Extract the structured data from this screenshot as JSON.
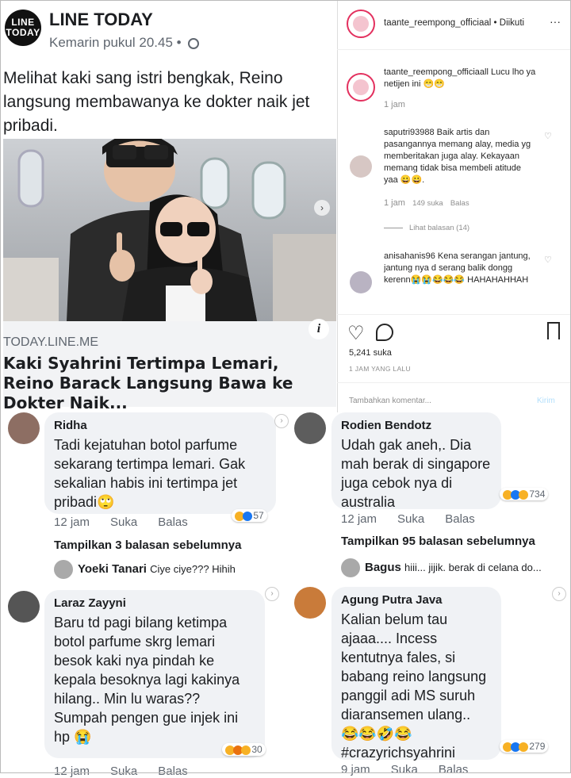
{
  "post": {
    "logo_line1": "LINE",
    "logo_line2": "TODAY",
    "brand": "LINE TODAY",
    "time": "Kemarin pukul 20.45 •",
    "caption": "Melihat kaki sang istri bengkak, Reino langsung membawanya ke dokter naik jet pribadi.",
    "link_domain": "TODAY.LINE.ME",
    "link_title": "Kaki Syahrini Tertimpa Lemari, Reino Barack Langsung Bawa ke Dokter Naik...",
    "info_icon": "i"
  },
  "instagram": {
    "header_user": "taante_reempong_officiaal",
    "header_follow": "• Diikuti",
    "more": "···",
    "c1_user": "taante_reempong_officiaall",
    "c1_text": "Lucu lho ya netijen ini 😁😁",
    "c1_time": "1 jam",
    "c2_user": "saputri93988",
    "c2_text": "Baik artis dan pasangannya memang alay, media yg memberitakan juga alay. Kekayaan memang tidak bisa membeli atitude yaa 😀😀.",
    "c2_time": "1 jam",
    "c2_likes": "149 suka",
    "c2_reply": "Balas",
    "c2_view": "Lihat balasan (14)",
    "c3_user": "anisahanis96",
    "c3_text": "Kena serangan jantung, jantung nya d serang balik dongg kerenn😭😭😂😂😂 HAHAHAHHAH",
    "likes": "5,241 suka",
    "posted": "1 JAM YANG LALU",
    "add_comment": "Tambahkan komentar...",
    "send": "Kirim"
  },
  "comments": [
    {
      "name": "Ridha",
      "body": "Tadi kejatuhan botol parfume sekarang tertimpa lemari. Gak sekalian habis ini tertimpa jet pribadi🙄",
      "time": "12 jam",
      "like": "Suka",
      "reply": "Balas",
      "reactions": "57",
      "replies": "Tampilkan 3 balasan sebelumnya",
      "reply_name": "Yoeki Tanari",
      "reply_text": "Ciye ciye??? Hihih"
    },
    {
      "name": "Rodien Bendotz",
      "body": "Udah gak aneh,. Dia mah berak di singapore juga cebok nya di australia",
      "time": "12 jam",
      "like": "Suka",
      "reply": "Balas",
      "reactions": "734",
      "replies": "Tampilkan 95 balasan sebelumnya",
      "reply_name": "Bagus",
      "reply_text": "hiii... jijik. berak di celana do..."
    },
    {
      "name": "Laraz Zayyni",
      "body": "Baru td pagi bilang ketimpa botol parfume skrg lemari besok kaki nya pindah ke kepala besoknya lagi kakinya hilang..  Min lu waras?? Sumpah pengen gue injek ini hp 😭",
      "time": "12 jam",
      "like": "Suka",
      "reply": "Balas",
      "reactions": "30"
    },
    {
      "name": "Agung Putra Java",
      "body": "Kalian belum tau ajaaa.... Incess kentutnya fales, si babang reino langsung panggil adi MS suruh diaransemen ulang.. 😂😂🤣😂 #crazyrichsyahrini",
      "time": "9 jam",
      "like": "Suka",
      "reply": "Balas",
      "reactions": "279"
    }
  ],
  "colors": {
    "like_blue": "#1877f2",
    "haha_yellow": "#f7b125",
    "angry_red": "#e9710f",
    "ig_accent": "#e3305e"
  }
}
